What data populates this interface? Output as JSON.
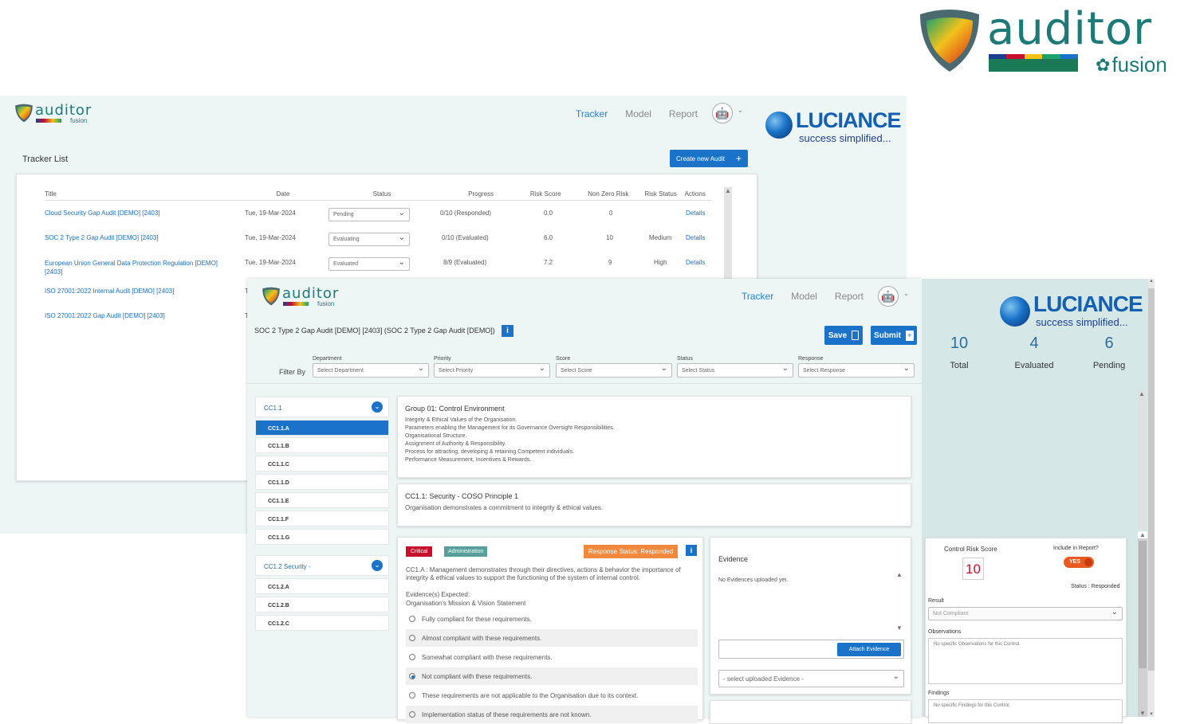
{
  "brand": {
    "word": "auditor",
    "sub": "fusion",
    "sub_icon": "fusion-flower-icon",
    "shield_icon": "shield-gradient-icon"
  },
  "luciance": {
    "word": "LUCIANCE",
    "tagline": "success simplified..."
  },
  "nav": {
    "tracker": "Tracker",
    "model": "Model",
    "report": "Report",
    "avatar_icon": "robot-avatar-icon"
  },
  "tracker": {
    "heading": "Tracker List",
    "create_button": "Create new Audit",
    "columns": [
      "Title",
      "Date",
      "Status",
      "Progress",
      "Risk Score",
      "Non Zero Risk",
      "Risk Status",
      "Actions"
    ],
    "rows": [
      {
        "title": "Cloud Security Gap Audit [DEMO] [2403]",
        "date": "Tue, 19-Mar-2024",
        "status": "Pending",
        "progress": "0/10 (Responded)",
        "risk_score": "0.0",
        "non_zero": "0",
        "risk_status": "",
        "action": "Details"
      },
      {
        "title": "SOC 2 Type 2 Gap Audit [DEMO] [2403]",
        "date": "Tue, 19-Mar-2024",
        "status": "Evaluating",
        "progress": "0/10 (Evaluated)",
        "risk_score": "6.0",
        "non_zero": "10",
        "risk_status": "Medium",
        "action": "Details"
      },
      {
        "title": "European Union General Data Protection Regulation [DEMO] [2403]",
        "date": "Tue, 19-Mar-2024",
        "status": "Evaluated",
        "progress": "8/9 (Evaluated)",
        "risk_score": "7.2",
        "non_zero": "9",
        "risk_status": "High",
        "action": "Details"
      },
      {
        "title": "ISO 27001:2022 Internal Audit [DEMO] [2403]",
        "date": "T"
      },
      {
        "title": "ISO 27001:2022 Gap Audit [DEMO] [2403]",
        "date": "T"
      }
    ]
  },
  "audit": {
    "title": "SOC 2 Type 2 Gap Audit [DEMO] [2403] (SOC 2 Type 2 Gap Audit [DEMO])",
    "save": "Save",
    "submit": "Submit",
    "filter_by": "Filter By",
    "filters": [
      {
        "label": "Department",
        "value": "Select Department"
      },
      {
        "label": "Priority",
        "value": "Select Priority"
      },
      {
        "label": "Score",
        "value": "Select Score"
      },
      {
        "label": "Status",
        "value": "Select Status"
      },
      {
        "label": "Response",
        "value": "Select Response"
      }
    ],
    "group1": {
      "name": "CC1.1",
      "items": [
        "CC1.1.A",
        "CC1.1.B",
        "CC1.1.C",
        "CC1.1.D",
        "CC1.1.E",
        "CC1.1.F",
        "CC1.1.G"
      ]
    },
    "group2": {
      "name": "CC1.2 Security -",
      "items": [
        "CC1.2.A",
        "CC1.2.B",
        "CC1.2.C"
      ]
    },
    "group_heading": "Group 01: Control Environment",
    "group_lines": [
      "Integrity & Ethical Values of the Organisation.",
      "Parameters enabling the Management for its Governance Oversight Responsibilities.",
      "Organisational Structure.",
      "Assignment of Authority & Responsibility.",
      "Process for attracting, developing & retaining Competent individuals.",
      "Performance Measurement, Incentives & Rewards."
    ],
    "principle_heading": "CC1.1: Security - COSO Principle 1",
    "principle_text": "Organisation demonstrates a commitment to integrity & ethical values.",
    "badge_critical": "Critical",
    "badge_admin": "Administration",
    "badge_response": "Response Status: Responded",
    "question": "CC1.A : Management demonstrates through their directives, actions & behavior the importance of integrity & ethical values to support the functioning of the system of internal control.",
    "evidence_expected": "Evidence(s) Expected:",
    "evidence_item": "Organisation's Mission & Vision Statement",
    "options": [
      "Fully compliant for these requirements.",
      "Almost compliant with these requirements.",
      "Somewhat compliant with these requirements.",
      "Not compliant with these requirements.",
      "These requirements are not applicable to the Organisation due to its context.",
      "Implementation status of these requirements are not known."
    ],
    "selected_option_index": 3,
    "evidence_heading": "Evidence",
    "no_evidence": "No Evidences uploaded yet.",
    "attach": "Attach Evidence",
    "select_evidence": "- select uploaded Evidence -"
  },
  "counters": [
    {
      "value": "10",
      "label": "Total"
    },
    {
      "value": "4",
      "label": "Evaluated"
    },
    {
      "value": "6",
      "label": "Pending"
    }
  ],
  "control": {
    "risk_label": "Control Risk Score",
    "risk_value": "10",
    "include_label": "Include in Report?",
    "include_value": "YES",
    "status": "Status : Responded",
    "result_label": "Result",
    "result_value": "Not Compliant",
    "observations_label": "Observations",
    "observations_placeholder": "No specific Observations for this Control.",
    "findings_label": "Findings",
    "findings_placeholder": "No specific Findings for this Control."
  },
  "colors": {
    "teal": "#1e7a78",
    "blue": "#1a73c8",
    "critical": "#c8102e",
    "admin": "#5a9e9c",
    "response": "#f0883e",
    "panel": "#edf5f5"
  }
}
